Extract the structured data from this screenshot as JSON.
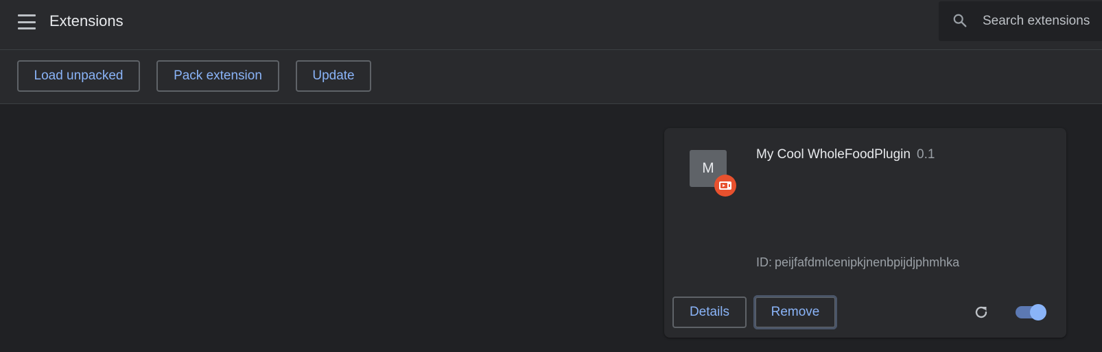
{
  "header": {
    "title": "Extensions",
    "menu_icon": "hamburger-menu-icon",
    "search": {
      "icon": "search-icon",
      "placeholder": "Search extensions"
    }
  },
  "toolbar": {
    "load_unpacked_label": "Load unpacked",
    "pack_extension_label": "Pack extension",
    "update_label": "Update"
  },
  "extension": {
    "icon_letter": "M",
    "badge_icon": "unpacked-extension-badge-icon",
    "name": "My Cool WholeFoodPlugin",
    "version": "0.1",
    "id_label": "ID:",
    "id": "peijfafdmlcenipkjnenbpijdjphmhka",
    "details_label": "Details",
    "remove_label": "Remove",
    "reload_icon": "reload-icon",
    "enabled": true
  },
  "colors": {
    "background": "#202124",
    "surface": "#292a2d",
    "accent": "#8ab4f8",
    "badge": "#e8512e",
    "border": "#5f6368"
  }
}
